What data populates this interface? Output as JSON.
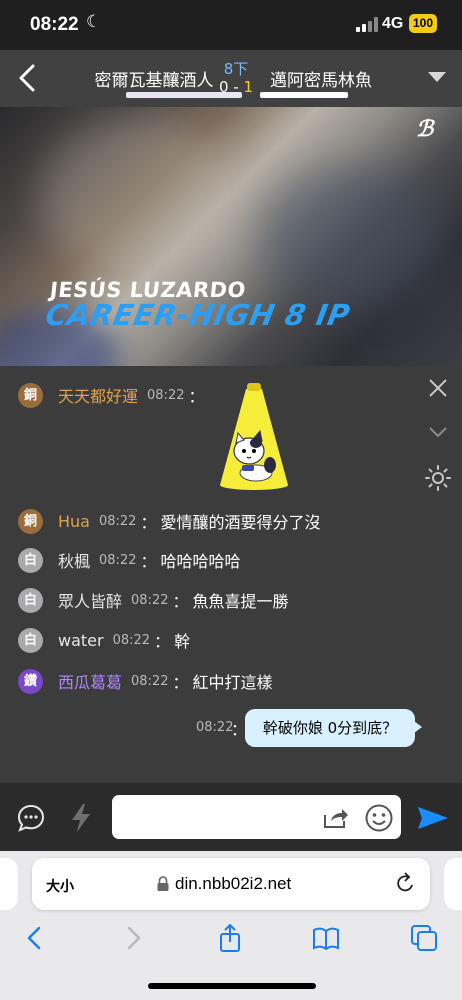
{
  "status_bar": {
    "time": "08:22",
    "network": "4G",
    "battery": "100",
    "icons": [
      "moon-icon",
      "signal-icon",
      "battery-icon"
    ]
  },
  "header": {
    "home_team": "密爾瓦基釀酒人",
    "away_team": "邁阿密馬林魚",
    "inning": "8下",
    "score_home": "0",
    "score_sep": " - ",
    "score_away": "1",
    "inning_color": "#7db8ff",
    "away_score_color": "#f7d400"
  },
  "video": {
    "logo": "ℬ",
    "caption_name": "JESÚS LUZARDO",
    "caption_stat": "CAREER-HIGH 8 IP"
  },
  "chat": {
    "messages": [
      {
        "badge": "銅",
        "user": "天天都好運",
        "time": "08:22",
        "colon": "：",
        "text": ""
      },
      {
        "badge": "銅",
        "user": "Hua",
        "time": "08:22",
        "colon": "：",
        "text": "愛情釀的酒要得分了沒"
      },
      {
        "badge": "白",
        "user": "秋楓",
        "time": "08:22",
        "colon": "：",
        "text": "哈哈哈哈哈"
      },
      {
        "badge": "白",
        "user": "眾人皆醉",
        "time": "08:22",
        "colon": "：",
        "text": "魚魚喜提一勝"
      },
      {
        "badge": "白",
        "user": "water",
        "time": "08:22",
        "colon": "：",
        "text": "幹"
      },
      {
        "badge": "鑽",
        "user": "西瓜葛葛",
        "time": "08:22",
        "colon": "：",
        "text": "紅中打這樣"
      }
    ],
    "my_message": {
      "time": "08:22",
      "colon": "：",
      "text": "幹破你娘  0分到底？"
    },
    "badge_colors": {
      "bronze": "#9a6d3d",
      "white": "#a9a9ab",
      "diamond": "#7a49c9"
    }
  },
  "input_bar": {
    "placeholder": "",
    "icons": [
      "chat-bubble-icon",
      "lightning-icon",
      "share-icon",
      "emoji-icon",
      "send-icon"
    ],
    "send_color": "#1a8cff"
  },
  "browser": {
    "text_size": "大小",
    "url": "din.nbb02i2.net",
    "icons": [
      "lock-icon",
      "reload-icon",
      "back-icon",
      "forward-icon",
      "share-icon",
      "bookmarks-icon",
      "tabs-icon"
    ]
  }
}
